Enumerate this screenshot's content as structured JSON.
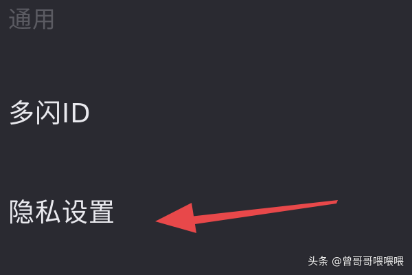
{
  "settings": {
    "section_header": "通用",
    "items": [
      {
        "label": "多闪ID"
      },
      {
        "label": "隐私设置"
      }
    ]
  },
  "annotation": {
    "arrow_color": "#e8484a",
    "arrow_target": "隐私设置"
  },
  "watermark": {
    "text": "头条 @曾哥哥喂喂喂"
  },
  "colors": {
    "background": "#2a2a31",
    "header_text": "#5b5b62",
    "item_text": "#e9e9ee"
  }
}
